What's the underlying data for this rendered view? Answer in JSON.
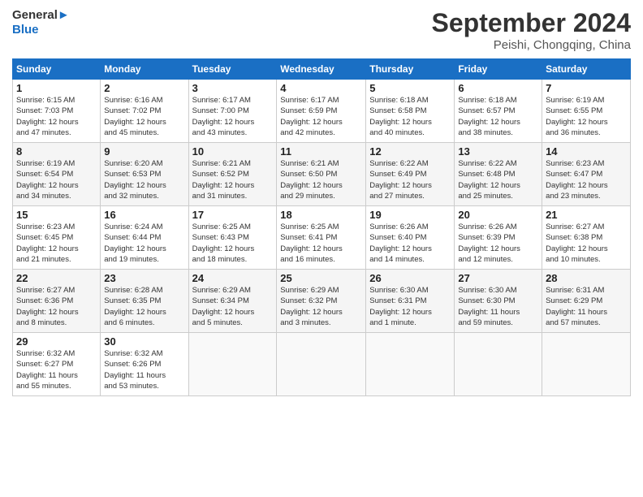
{
  "header": {
    "logo_line1": "General",
    "logo_line2": "Blue",
    "month": "September 2024",
    "location": "Peishi, Chongqing, China"
  },
  "weekdays": [
    "Sunday",
    "Monday",
    "Tuesday",
    "Wednesday",
    "Thursday",
    "Friday",
    "Saturday"
  ],
  "weeks": [
    [
      {
        "day": "1",
        "info": "Sunrise: 6:15 AM\nSunset: 7:03 PM\nDaylight: 12 hours\nand 47 minutes."
      },
      {
        "day": "2",
        "info": "Sunrise: 6:16 AM\nSunset: 7:02 PM\nDaylight: 12 hours\nand 45 minutes."
      },
      {
        "day": "3",
        "info": "Sunrise: 6:17 AM\nSunset: 7:00 PM\nDaylight: 12 hours\nand 43 minutes."
      },
      {
        "day": "4",
        "info": "Sunrise: 6:17 AM\nSunset: 6:59 PM\nDaylight: 12 hours\nand 42 minutes."
      },
      {
        "day": "5",
        "info": "Sunrise: 6:18 AM\nSunset: 6:58 PM\nDaylight: 12 hours\nand 40 minutes."
      },
      {
        "day": "6",
        "info": "Sunrise: 6:18 AM\nSunset: 6:57 PM\nDaylight: 12 hours\nand 38 minutes."
      },
      {
        "day": "7",
        "info": "Sunrise: 6:19 AM\nSunset: 6:55 PM\nDaylight: 12 hours\nand 36 minutes."
      }
    ],
    [
      {
        "day": "8",
        "info": "Sunrise: 6:19 AM\nSunset: 6:54 PM\nDaylight: 12 hours\nand 34 minutes."
      },
      {
        "day": "9",
        "info": "Sunrise: 6:20 AM\nSunset: 6:53 PM\nDaylight: 12 hours\nand 32 minutes."
      },
      {
        "day": "10",
        "info": "Sunrise: 6:21 AM\nSunset: 6:52 PM\nDaylight: 12 hours\nand 31 minutes."
      },
      {
        "day": "11",
        "info": "Sunrise: 6:21 AM\nSunset: 6:50 PM\nDaylight: 12 hours\nand 29 minutes."
      },
      {
        "day": "12",
        "info": "Sunrise: 6:22 AM\nSunset: 6:49 PM\nDaylight: 12 hours\nand 27 minutes."
      },
      {
        "day": "13",
        "info": "Sunrise: 6:22 AM\nSunset: 6:48 PM\nDaylight: 12 hours\nand 25 minutes."
      },
      {
        "day": "14",
        "info": "Sunrise: 6:23 AM\nSunset: 6:47 PM\nDaylight: 12 hours\nand 23 minutes."
      }
    ],
    [
      {
        "day": "15",
        "info": "Sunrise: 6:23 AM\nSunset: 6:45 PM\nDaylight: 12 hours\nand 21 minutes."
      },
      {
        "day": "16",
        "info": "Sunrise: 6:24 AM\nSunset: 6:44 PM\nDaylight: 12 hours\nand 19 minutes."
      },
      {
        "day": "17",
        "info": "Sunrise: 6:25 AM\nSunset: 6:43 PM\nDaylight: 12 hours\nand 18 minutes."
      },
      {
        "day": "18",
        "info": "Sunrise: 6:25 AM\nSunset: 6:41 PM\nDaylight: 12 hours\nand 16 minutes."
      },
      {
        "day": "19",
        "info": "Sunrise: 6:26 AM\nSunset: 6:40 PM\nDaylight: 12 hours\nand 14 minutes."
      },
      {
        "day": "20",
        "info": "Sunrise: 6:26 AM\nSunset: 6:39 PM\nDaylight: 12 hours\nand 12 minutes."
      },
      {
        "day": "21",
        "info": "Sunrise: 6:27 AM\nSunset: 6:38 PM\nDaylight: 12 hours\nand 10 minutes."
      }
    ],
    [
      {
        "day": "22",
        "info": "Sunrise: 6:27 AM\nSunset: 6:36 PM\nDaylight: 12 hours\nand 8 minutes."
      },
      {
        "day": "23",
        "info": "Sunrise: 6:28 AM\nSunset: 6:35 PM\nDaylight: 12 hours\nand 6 minutes."
      },
      {
        "day": "24",
        "info": "Sunrise: 6:29 AM\nSunset: 6:34 PM\nDaylight: 12 hours\nand 5 minutes."
      },
      {
        "day": "25",
        "info": "Sunrise: 6:29 AM\nSunset: 6:32 PM\nDaylight: 12 hours\nand 3 minutes."
      },
      {
        "day": "26",
        "info": "Sunrise: 6:30 AM\nSunset: 6:31 PM\nDaylight: 12 hours\nand 1 minute."
      },
      {
        "day": "27",
        "info": "Sunrise: 6:30 AM\nSunset: 6:30 PM\nDaylight: 11 hours\nand 59 minutes."
      },
      {
        "day": "28",
        "info": "Sunrise: 6:31 AM\nSunset: 6:29 PM\nDaylight: 11 hours\nand 57 minutes."
      }
    ],
    [
      {
        "day": "29",
        "info": "Sunrise: 6:32 AM\nSunset: 6:27 PM\nDaylight: 11 hours\nand 55 minutes."
      },
      {
        "day": "30",
        "info": "Sunrise: 6:32 AM\nSunset: 6:26 PM\nDaylight: 11 hours\nand 53 minutes."
      },
      {
        "day": "",
        "info": ""
      },
      {
        "day": "",
        "info": ""
      },
      {
        "day": "",
        "info": ""
      },
      {
        "day": "",
        "info": ""
      },
      {
        "day": "",
        "info": ""
      }
    ]
  ]
}
